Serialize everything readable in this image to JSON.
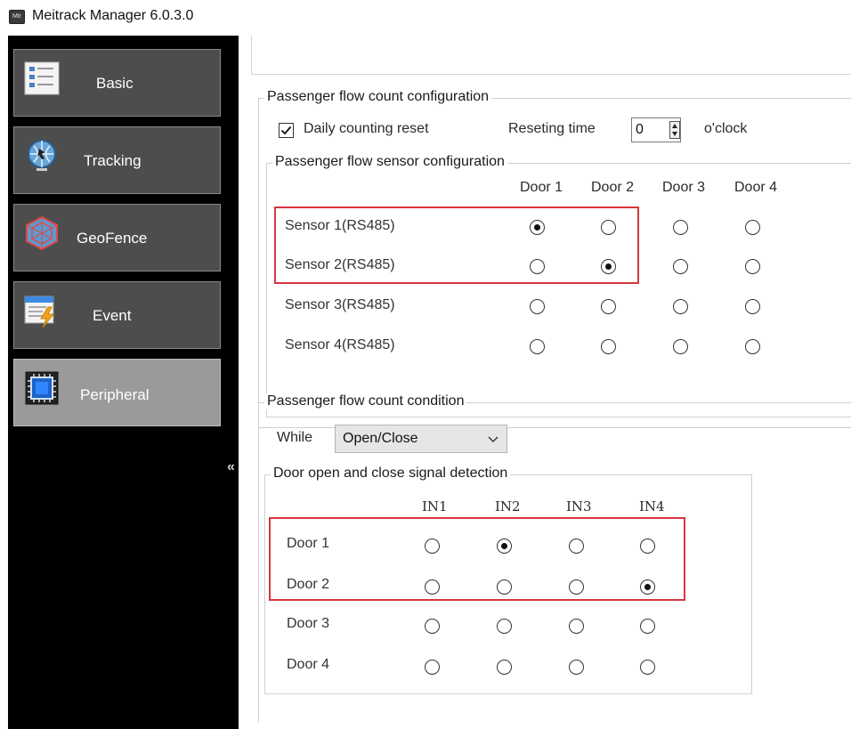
{
  "window": {
    "title": "Meitrack Manager 6.0.3.0",
    "icon_text": "Mtr"
  },
  "sidebar": {
    "items": [
      {
        "label": "Basic",
        "icon": "checklist-icon",
        "active": false
      },
      {
        "label": "Tracking",
        "icon": "globe-tracking-icon",
        "active": false
      },
      {
        "label": "GeoFence",
        "icon": "geofence-icon",
        "active": false
      },
      {
        "label": "Event",
        "icon": "event-lightning-icon",
        "active": false
      },
      {
        "label": "Peripheral",
        "icon": "chip-icon",
        "active": true
      }
    ],
    "collapse_label": "«"
  },
  "count_config": {
    "title": "Passenger flow count configuration",
    "daily_reset_label": "Daily counting reset",
    "daily_reset_checked": true,
    "reset_time_label": "Reseting time",
    "reset_time_value": "0",
    "reset_time_unit": "o'clock"
  },
  "sensor_config": {
    "title": "Passenger flow sensor configuration",
    "columns": [
      "Door 1",
      "Door 2",
      "Door 3",
      "Door 4"
    ],
    "rows": [
      {
        "label": "Sensor 1(RS485)",
        "selected": 0
      },
      {
        "label": "Sensor 2(RS485)",
        "selected": 1
      },
      {
        "label": "Sensor 3(RS485)",
        "selected": null
      },
      {
        "label": "Sensor 4(RS485)",
        "selected": null
      }
    ]
  },
  "count_condition": {
    "title": "Passenger flow count condition",
    "while_label": "While",
    "while_value": "Open/Close"
  },
  "door_detection": {
    "title": "Door open and close signal detection",
    "columns": [
      "IN1",
      "IN2",
      "IN3",
      "IN4"
    ],
    "rows": [
      {
        "label": "Door 1",
        "selected": 1
      },
      {
        "label": "Door 2",
        "selected": 3
      },
      {
        "label": "Door 3",
        "selected": null
      },
      {
        "label": "Door 4",
        "selected": null
      }
    ]
  },
  "highlight_color": "#d9363e"
}
